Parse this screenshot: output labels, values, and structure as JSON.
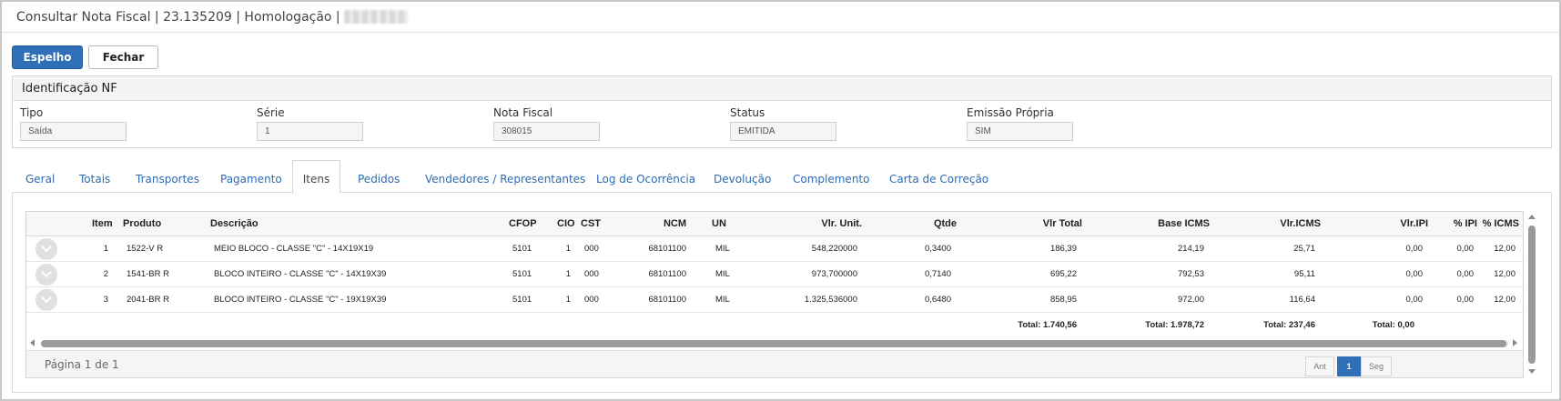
{
  "window": {
    "title": "Consultar Nota Fiscal | 23.135209 | Homologação |"
  },
  "toolbar": {
    "espelho_label": "Espelho",
    "fechar_label": "Fechar"
  },
  "identificacao": {
    "heading": "Identificação NF",
    "fields": [
      {
        "label": "Tipo",
        "value": "Saída"
      },
      {
        "label": "Série",
        "value": "1"
      },
      {
        "label": "Nota Fiscal",
        "value": "308015"
      },
      {
        "label": "Status",
        "value": "EMITIDA"
      },
      {
        "label": "Emissão Própria",
        "value": "SIM"
      }
    ]
  },
  "tabs": [
    {
      "label": "Geral"
    },
    {
      "label": "Totais"
    },
    {
      "label": "Transportes"
    },
    {
      "label": "Pagamento"
    },
    {
      "label": "Itens",
      "active": true
    },
    {
      "label": "Pedidos"
    },
    {
      "label": "Vendedores / Representantes"
    },
    {
      "label": "Log de Ocorrência"
    },
    {
      "label": "Devolução"
    },
    {
      "label": "Complemento"
    },
    {
      "label": "Carta de Correção"
    }
  ],
  "grid": {
    "columns": [
      "Item",
      "Produto",
      "Descrição",
      "CFOP",
      "CIO",
      "CST",
      "NCM",
      "UN",
      "Vlr. Unit.",
      "Qtde",
      "Vlr Total",
      "Base ICMS",
      "Vlr.ICMS",
      "Vlr.IPI",
      "% IPI",
      "% ICMS"
    ],
    "rows": [
      {
        "item": "1",
        "produto": "1522-V R",
        "descricao": "MEIO BLOCO - CLASSE \"C\" - 14X19X19",
        "cfop": "5101",
        "cio": "1",
        "cst": "000",
        "ncm": "68101100",
        "un": "MIL",
        "vlr_unit": "548,220000",
        "qtde": "0,3400",
        "vlr_total": "186,39",
        "base_icms": "214,19",
        "vlr_icms": "25,71",
        "vlr_ipi": "0,00",
        "pct_ipi": "0,00",
        "pct_icms": "12,00"
      },
      {
        "item": "2",
        "produto": "1541-BR R",
        "descricao": "BLOCO INTEIRO - CLASSE \"C\" - 14X19X39",
        "cfop": "5101",
        "cio": "1",
        "cst": "000",
        "ncm": "68101100",
        "un": "MIL",
        "vlr_unit": "973,700000",
        "qtde": "0,7140",
        "vlr_total": "695,22",
        "base_icms": "792,53",
        "vlr_icms": "95,11",
        "vlr_ipi": "0,00",
        "pct_ipi": "0,00",
        "pct_icms": "12,00"
      },
      {
        "item": "3",
        "produto": "2041-BR R",
        "descricao": "BLOCO INTEIRO - CLASSE \"C\" - 19X19X39",
        "cfop": "5101",
        "cio": "1",
        "cst": "000",
        "ncm": "68101100",
        "un": "MIL",
        "vlr_unit": "1.325,536000",
        "qtde": "0,6480",
        "vlr_total": "858,95",
        "base_icms": "972,00",
        "vlr_icms": "116,64",
        "vlr_ipi": "0,00",
        "pct_ipi": "0,00",
        "pct_icms": "12,00"
      }
    ],
    "totals": {
      "vlr_total": "Total: 1.740,56",
      "base_icms": "Total: 1.978,72",
      "vlr_icms": "Total: 237,46",
      "vlr_ipi": "Total: 0,00"
    }
  },
  "pagination": {
    "info": "Página 1 de 1",
    "prev_label": "Ant",
    "current_label": "1",
    "next_label": "Seg"
  }
}
